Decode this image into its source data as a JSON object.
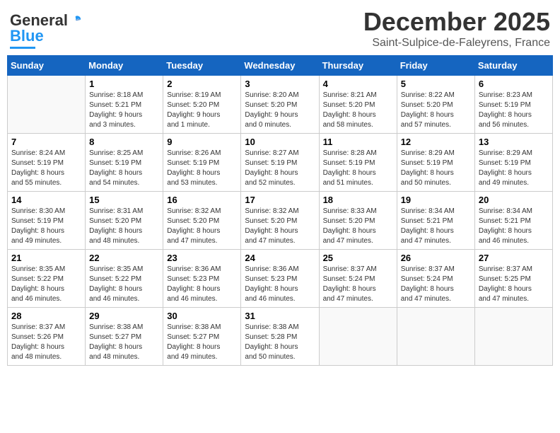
{
  "logo": {
    "part1": "General",
    "part2": "Blue"
  },
  "title": "December 2025",
  "subtitle": "Saint-Sulpice-de-Faleyrens, France",
  "days_of_week": [
    "Sunday",
    "Monday",
    "Tuesday",
    "Wednesday",
    "Thursday",
    "Friday",
    "Saturday"
  ],
  "weeks": [
    [
      {
        "day": "",
        "info": ""
      },
      {
        "day": "1",
        "info": "Sunrise: 8:18 AM\nSunset: 5:21 PM\nDaylight: 9 hours\nand 3 minutes."
      },
      {
        "day": "2",
        "info": "Sunrise: 8:19 AM\nSunset: 5:20 PM\nDaylight: 9 hours\nand 1 minute."
      },
      {
        "day": "3",
        "info": "Sunrise: 8:20 AM\nSunset: 5:20 PM\nDaylight: 9 hours\nand 0 minutes."
      },
      {
        "day": "4",
        "info": "Sunrise: 8:21 AM\nSunset: 5:20 PM\nDaylight: 8 hours\nand 58 minutes."
      },
      {
        "day": "5",
        "info": "Sunrise: 8:22 AM\nSunset: 5:20 PM\nDaylight: 8 hours\nand 57 minutes."
      },
      {
        "day": "6",
        "info": "Sunrise: 8:23 AM\nSunset: 5:19 PM\nDaylight: 8 hours\nand 56 minutes."
      }
    ],
    [
      {
        "day": "7",
        "info": "Sunrise: 8:24 AM\nSunset: 5:19 PM\nDaylight: 8 hours\nand 55 minutes."
      },
      {
        "day": "8",
        "info": "Sunrise: 8:25 AM\nSunset: 5:19 PM\nDaylight: 8 hours\nand 54 minutes."
      },
      {
        "day": "9",
        "info": "Sunrise: 8:26 AM\nSunset: 5:19 PM\nDaylight: 8 hours\nand 53 minutes."
      },
      {
        "day": "10",
        "info": "Sunrise: 8:27 AM\nSunset: 5:19 PM\nDaylight: 8 hours\nand 52 minutes."
      },
      {
        "day": "11",
        "info": "Sunrise: 8:28 AM\nSunset: 5:19 PM\nDaylight: 8 hours\nand 51 minutes."
      },
      {
        "day": "12",
        "info": "Sunrise: 8:29 AM\nSunset: 5:19 PM\nDaylight: 8 hours\nand 50 minutes."
      },
      {
        "day": "13",
        "info": "Sunrise: 8:29 AM\nSunset: 5:19 PM\nDaylight: 8 hours\nand 49 minutes."
      }
    ],
    [
      {
        "day": "14",
        "info": "Sunrise: 8:30 AM\nSunset: 5:19 PM\nDaylight: 8 hours\nand 49 minutes."
      },
      {
        "day": "15",
        "info": "Sunrise: 8:31 AM\nSunset: 5:20 PM\nDaylight: 8 hours\nand 48 minutes."
      },
      {
        "day": "16",
        "info": "Sunrise: 8:32 AM\nSunset: 5:20 PM\nDaylight: 8 hours\nand 47 minutes."
      },
      {
        "day": "17",
        "info": "Sunrise: 8:32 AM\nSunset: 5:20 PM\nDaylight: 8 hours\nand 47 minutes."
      },
      {
        "day": "18",
        "info": "Sunrise: 8:33 AM\nSunset: 5:20 PM\nDaylight: 8 hours\nand 47 minutes."
      },
      {
        "day": "19",
        "info": "Sunrise: 8:34 AM\nSunset: 5:21 PM\nDaylight: 8 hours\nand 47 minutes."
      },
      {
        "day": "20",
        "info": "Sunrise: 8:34 AM\nSunset: 5:21 PM\nDaylight: 8 hours\nand 46 minutes."
      }
    ],
    [
      {
        "day": "21",
        "info": "Sunrise: 8:35 AM\nSunset: 5:22 PM\nDaylight: 8 hours\nand 46 minutes."
      },
      {
        "day": "22",
        "info": "Sunrise: 8:35 AM\nSunset: 5:22 PM\nDaylight: 8 hours\nand 46 minutes."
      },
      {
        "day": "23",
        "info": "Sunrise: 8:36 AM\nSunset: 5:23 PM\nDaylight: 8 hours\nand 46 minutes."
      },
      {
        "day": "24",
        "info": "Sunrise: 8:36 AM\nSunset: 5:23 PM\nDaylight: 8 hours\nand 46 minutes."
      },
      {
        "day": "25",
        "info": "Sunrise: 8:37 AM\nSunset: 5:24 PM\nDaylight: 8 hours\nand 47 minutes."
      },
      {
        "day": "26",
        "info": "Sunrise: 8:37 AM\nSunset: 5:24 PM\nDaylight: 8 hours\nand 47 minutes."
      },
      {
        "day": "27",
        "info": "Sunrise: 8:37 AM\nSunset: 5:25 PM\nDaylight: 8 hours\nand 47 minutes."
      }
    ],
    [
      {
        "day": "28",
        "info": "Sunrise: 8:37 AM\nSunset: 5:26 PM\nDaylight: 8 hours\nand 48 minutes."
      },
      {
        "day": "29",
        "info": "Sunrise: 8:38 AM\nSunset: 5:27 PM\nDaylight: 8 hours\nand 48 minutes."
      },
      {
        "day": "30",
        "info": "Sunrise: 8:38 AM\nSunset: 5:27 PM\nDaylight: 8 hours\nand 49 minutes."
      },
      {
        "day": "31",
        "info": "Sunrise: 8:38 AM\nSunset: 5:28 PM\nDaylight: 8 hours\nand 50 minutes."
      },
      {
        "day": "",
        "info": ""
      },
      {
        "day": "",
        "info": ""
      },
      {
        "day": "",
        "info": ""
      }
    ]
  ]
}
